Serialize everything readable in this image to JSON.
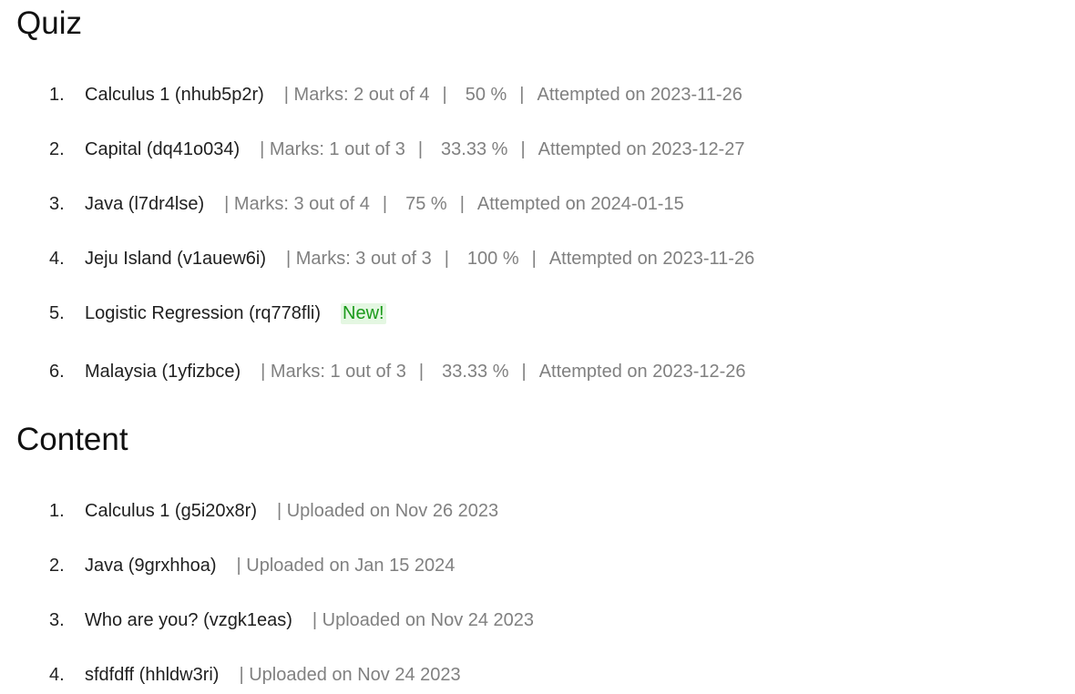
{
  "quiz": {
    "title": "Quiz",
    "items": [
      {
        "index": "1.",
        "name": "Calculus 1 (nhub5p2r)",
        "marks": "| Marks: 2 out of 4",
        "percent": "50 %",
        "attempted": "Attempted on 2023-11-26"
      },
      {
        "index": "2.",
        "name": "Capital (dq41o034)",
        "marks": "| Marks: 1 out of 3",
        "percent": "33.33 %",
        "attempted": "Attempted on 2023-12-27"
      },
      {
        "index": "3.",
        "name": "Java (l7dr4lse)",
        "marks": "| Marks: 3 out of 4",
        "percent": "75 %",
        "attempted": "Attempted on 2024-01-15"
      },
      {
        "index": "4.",
        "name": "Jeju Island (v1auew6i)",
        "marks": "| Marks: 3 out of 3",
        "percent": "100 %",
        "attempted": "Attempted on 2023-11-26"
      },
      {
        "index": "5.",
        "name": "Logistic Regression (rq778fli)",
        "badge": "New!"
      },
      {
        "index": "6.",
        "name": "Malaysia (1yfizbce)",
        "marks": "| Marks: 1 out of 3",
        "percent": "33.33 %",
        "attempted": "Attempted on 2023-12-26"
      }
    ],
    "separator": "|"
  },
  "content": {
    "title": "Content",
    "items": [
      {
        "index": "1.",
        "name": "Calculus 1 (g5i20x8r)",
        "uploaded": "| Uploaded on Nov 26 2023"
      },
      {
        "index": "2.",
        "name": "Java (9grxhhoa)",
        "uploaded": "| Uploaded on Jan 15 2024"
      },
      {
        "index": "3.",
        "name": "Who are you? (vzgk1eas)",
        "uploaded": "| Uploaded on Nov 24 2023"
      },
      {
        "index": "4.",
        "name": "sfdfdff (hhldw3ri)",
        "uploaded": "| Uploaded on Nov 24 2023"
      }
    ]
  },
  "colors": {
    "meta_text": "#808080",
    "badge_bg": "#e4f7e2",
    "badge_text": "#1a9a1a"
  }
}
